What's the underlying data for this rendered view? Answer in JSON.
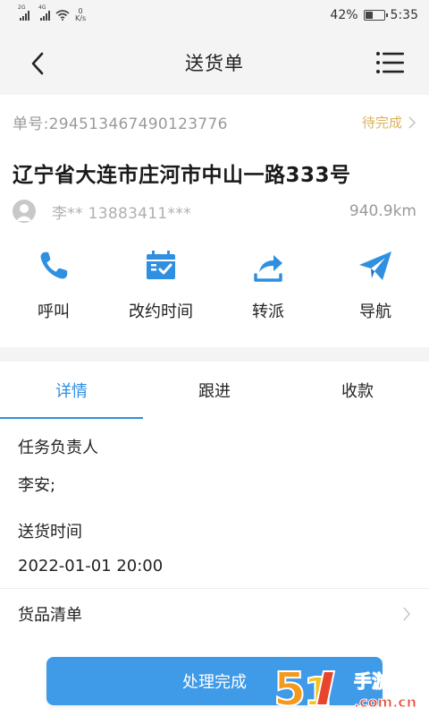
{
  "status_bar": {
    "signal1_tag": "2G",
    "signal2_tag": "4G",
    "net_speed_value": "0",
    "net_speed_unit": "K/s",
    "battery_percent": "42%",
    "battery_level": 0.42,
    "time": "5:35"
  },
  "header": {
    "title": "送货单",
    "back_icon": "chevron-left-icon",
    "menu_icon": "list-menu-icon"
  },
  "order": {
    "number": "单号:294513467490123776",
    "status": "待完成",
    "address": "辽宁省大连市庄河市中山一路333号",
    "contact": "李** 13883411***",
    "distance": "940.9km"
  },
  "actions": [
    {
      "label": "呼叫",
      "icon": "phone-icon"
    },
    {
      "label": "改约时间",
      "icon": "calendar-check-icon"
    },
    {
      "label": "转派",
      "icon": "share-forward-icon"
    },
    {
      "label": "导航",
      "icon": "paper-plane-icon"
    }
  ],
  "tabs": [
    {
      "label": "详情",
      "active": true
    },
    {
      "label": "跟进",
      "active": false
    },
    {
      "label": "收款",
      "active": false
    }
  ],
  "details": {
    "owner_label": "任务负责人",
    "owner_value": "李安;",
    "delivery_time_label": "送货时间",
    "delivery_time_value": "2022-01-01 20:00",
    "goods_label": "货品清单"
  },
  "primary_button": "处理完成",
  "watermark": {
    "text_top": "手游网",
    "text_bottom": ".com.cn",
    "logo_text": "5",
    "logo_suffix": "1"
  },
  "colors": {
    "accent": "#2f8fe0",
    "button": "#3f9ae8",
    "status": "#d9b45a"
  }
}
